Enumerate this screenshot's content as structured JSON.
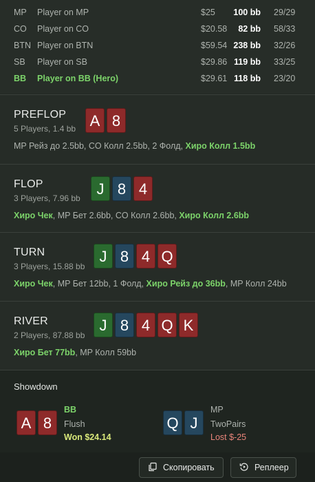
{
  "players": [
    {
      "pos": "MP",
      "name": "Player on MP",
      "money": "$25",
      "bb": "100 bb",
      "ratio": "29/29",
      "hero": false
    },
    {
      "pos": "CO",
      "name": "Player on CO",
      "money": "$20.58",
      "bb": "82 bb",
      "ratio": "58/33",
      "hero": false
    },
    {
      "pos": "BTN",
      "name": "Player on BTN",
      "money": "$59.54",
      "bb": "238 bb",
      "ratio": "32/26",
      "hero": false
    },
    {
      "pos": "SB",
      "name": "Player on SB",
      "money": "$29.86",
      "bb": "119 bb",
      "ratio": "33/25",
      "hero": false
    },
    {
      "pos": "BB",
      "name": "Player on BB (Hero)",
      "money": "$29.61",
      "bb": "118 bb",
      "ratio": "23/20",
      "hero": true
    }
  ],
  "preflop": {
    "title": "PREFLOP",
    "sub": "5 Players, 1.4 bb",
    "cards": [
      {
        "r": "A",
        "c": "red"
      },
      {
        "r": "8",
        "c": "red"
      }
    ],
    "actions": [
      {
        "t": "MP Рейз до 2.5bb, CO Колл 2.5bb, 2 Фолд, ",
        "hl": false
      },
      {
        "t": "Хиро Колл 1.5bb",
        "hl": true
      }
    ]
  },
  "flop": {
    "title": "FLOP",
    "sub": "3 Players, 7.96 bb",
    "cards": [
      {
        "r": "J",
        "c": "green"
      },
      {
        "r": "8",
        "c": "blue"
      },
      {
        "r": "4",
        "c": "red"
      }
    ],
    "actions": [
      {
        "t": "Хиро Чек",
        "hl": true
      },
      {
        "t": ", MP Бет 2.6bb, CO Колл 2.6bb, ",
        "hl": false
      },
      {
        "t": "Хиро Колл 2.6bb",
        "hl": true
      }
    ]
  },
  "turn": {
    "title": "TURN",
    "sub": "3 Players, 15.88 bb",
    "cards": [
      {
        "r": "J",
        "c": "green"
      },
      {
        "r": "8",
        "c": "blue"
      },
      {
        "r": "4",
        "c": "red"
      },
      {
        "r": "Q",
        "c": "red"
      }
    ],
    "actions": [
      {
        "t": "Хиро Чек",
        "hl": true
      },
      {
        "t": ", MP Бет 12bb, 1 Фолд, ",
        "hl": false
      },
      {
        "t": "Хиро Рейз до 36bb",
        "hl": true
      },
      {
        "t": ", MP Колл 24bb",
        "hl": false
      }
    ]
  },
  "river": {
    "title": "RIVER",
    "sub": "2 Players, 87.88 bb",
    "cards": [
      {
        "r": "J",
        "c": "green"
      },
      {
        "r": "8",
        "c": "blue"
      },
      {
        "r": "4",
        "c": "red"
      },
      {
        "r": "Q",
        "c": "red"
      },
      {
        "r": "K",
        "c": "red"
      }
    ],
    "actions": [
      {
        "t": "Хиро Бет 77bb",
        "hl": true
      },
      {
        "t": ", MP Колл 59bb",
        "hl": false
      }
    ]
  },
  "showdown": {
    "title": "Showdown",
    "hero": {
      "pos": "BB",
      "hand": "Flush",
      "result": "Won $24.14",
      "cards": [
        {
          "r": "A",
          "c": "red"
        },
        {
          "r": "8",
          "c": "red"
        }
      ]
    },
    "villain": {
      "pos": "MP",
      "hand": "TwoPairs",
      "result": "Lost $-25",
      "cards": [
        {
          "r": "Q",
          "c": "blue"
        },
        {
          "r": "J",
          "c": "blue"
        }
      ]
    }
  },
  "footer": {
    "copy_label": "Скопировать",
    "replay_label": "Реплеер"
  },
  "colors": {
    "red": "#8e2a2a",
    "green": "#2a6a2f",
    "blue": "#25475e",
    "hero": "#7cd36a",
    "won": "#d9e87a",
    "lost": "#e8847a"
  }
}
